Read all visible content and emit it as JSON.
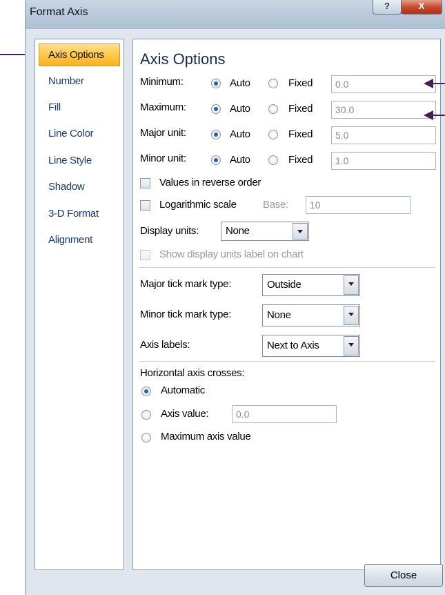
{
  "window": {
    "title": "Format Axis",
    "help_label": "?",
    "close_label": "X"
  },
  "nav": {
    "items": [
      "Axis Options",
      "Number",
      "Fill",
      "Line Color",
      "Line Style",
      "Shadow",
      "3-D Format",
      "Alignment"
    ],
    "selected": "Axis Options"
  },
  "axis_options": {
    "title": "Axis Options",
    "auto_label": "Auto",
    "fixed_label": "Fixed",
    "minimum": {
      "label": "Minimum:",
      "mode": "Auto",
      "value": "0.0"
    },
    "maximum": {
      "label": "Maximum:",
      "mode": "Auto",
      "value": "30.0"
    },
    "major_unit": {
      "label": "Major unit:",
      "mode": "Auto",
      "value": "5.0"
    },
    "minor_unit": {
      "label": "Minor unit:",
      "mode": "Auto",
      "value": "1.0"
    },
    "reverse_order": {
      "label": "Values in reverse order",
      "checked": false
    },
    "log_scale": {
      "label": "Logarithmic scale",
      "checked": false,
      "base_label": "Base:",
      "base_value": "10"
    },
    "display_units": {
      "label": "Display units:",
      "value": "None"
    },
    "show_units_label": {
      "label": "Show display units label on chart",
      "checked": false,
      "enabled": false
    },
    "major_tick": {
      "label": "Major tick mark type:",
      "value": "Outside"
    },
    "minor_tick": {
      "label": "Minor tick mark type:",
      "value": "None"
    },
    "axis_labels": {
      "label": "Axis labels:",
      "value": "Next to Axis"
    },
    "crosses": {
      "label": "Horizontal axis crosses:",
      "automatic_label": "Automatic",
      "axis_value_label": "Axis value:",
      "axis_value": "0.0",
      "max_label": "Maximum axis value",
      "selected": "Automatic"
    }
  },
  "footer": {
    "close_button": "Close"
  },
  "colors": {
    "selected_nav": "#ffc94a",
    "nav_text": "#1a3a6a",
    "annotation_arrow": "#4a1a5a"
  }
}
